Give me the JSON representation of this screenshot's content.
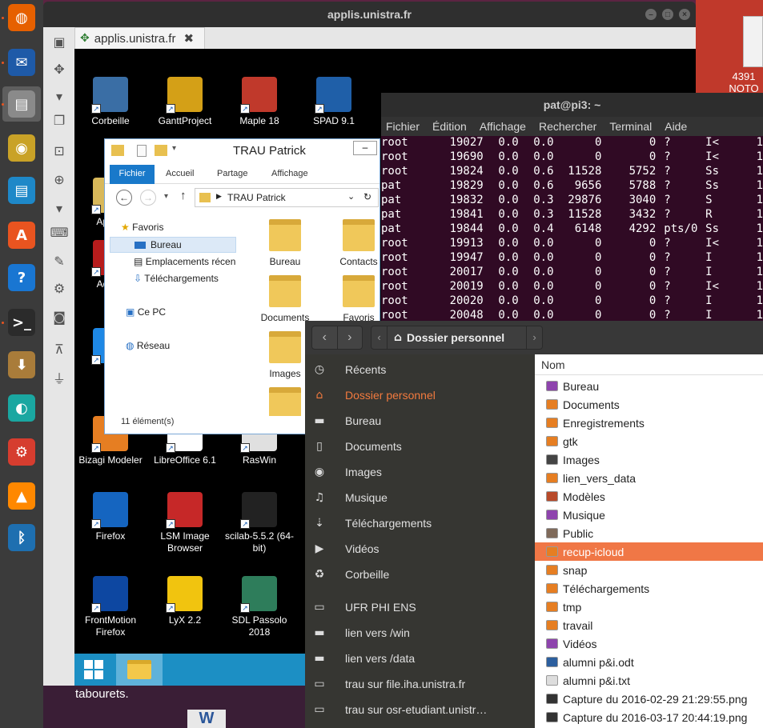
{
  "dock": {
    "items": [
      {
        "name": "firefox",
        "icon": "firefox-icon"
      },
      {
        "name": "thunderbird",
        "icon": "mail-icon"
      },
      {
        "name": "files",
        "icon": "files-icon"
      },
      {
        "name": "rhythmbox",
        "icon": "speaker-icon"
      },
      {
        "name": "writer",
        "icon": "writer-icon"
      },
      {
        "name": "software",
        "icon": "software-store-icon"
      },
      {
        "name": "help",
        "icon": "help-icon"
      },
      {
        "name": "terminal",
        "icon": "terminal-icon"
      },
      {
        "name": "archive",
        "icon": "archive-icon"
      },
      {
        "name": "remmina",
        "icon": "remote-desktop-icon"
      },
      {
        "name": "settings",
        "icon": "settings-icon"
      },
      {
        "name": "vlc",
        "icon": "vlc-icon"
      },
      {
        "name": "bluetooth",
        "icon": "bluetooth-icon"
      }
    ]
  },
  "right_desktop": {
    "label1": "4391",
    "label2": "NOTO"
  },
  "remote_window": {
    "title": "applis.unistra.fr",
    "tab_label": "applis.unistra.fr",
    "desktop_icons": [
      {
        "label": "Corbeille",
        "color": "#3a6ea5"
      },
      {
        "label": "GanttProject",
        "color": "#d4a017"
      },
      {
        "label": "Maple 18",
        "color": "#c0392b"
      },
      {
        "label": "SPAD 9.1",
        "color": "#1f5fa8"
      },
      {
        "label": "Appl P",
        "color": "#d8b85a"
      },
      {
        "label": "Adobe",
        "color": "#b71c1c"
      },
      {
        "label": "A",
        "color": "#1e88e5"
      },
      {
        "label": "Bizagi Modeler",
        "color": "#e67e22"
      },
      {
        "label": "LibreOffice 6.1",
        "color": "#ffffff"
      },
      {
        "label": "RasWin",
        "color": "#e0e0e0"
      },
      {
        "label": "Firefox",
        "color": "#1565c0"
      },
      {
        "label": "LSM Image Browser",
        "color": "#c62828"
      },
      {
        "label": "scilab-5.5.2 (64-bit)",
        "color": "#222222"
      },
      {
        "label": "FrontMotion Firefox",
        "color": "#0d47a1"
      },
      {
        "label": "LyX 2.2",
        "color": "#f1c40f"
      },
      {
        "label": "SDL Passolo 2018",
        "color": "#2e7d5b"
      }
    ],
    "bottom_text": "tabourets."
  },
  "explorer": {
    "title": "TRAU Patrick",
    "ribbon_tabs": [
      "Fichier",
      "Accueil",
      "Partage",
      "Affichage"
    ],
    "address": "TRAU Patrick",
    "nav": {
      "favoris": "Favoris",
      "bureau": "Bureau",
      "emplacements": "Emplacements récen",
      "telechargements": "Téléchargements",
      "ce_pc": "Ce PC",
      "reseau": "Réseau"
    },
    "items": [
      "Bureau",
      "Contacts",
      "Documents",
      "Favoris",
      "Images",
      ""
    ],
    "status": "11 élément(s)"
  },
  "terminal": {
    "title": "pat@pi3: ~",
    "menu": [
      "Fichier",
      "Édition",
      "Affichage",
      "Rechercher",
      "Terminal",
      "Aide"
    ],
    "rows": [
      [
        "root",
        "19027",
        "0.0",
        "0.0",
        "0",
        "0",
        "?",
        "I<",
        "1"
      ],
      [
        "root",
        "19690",
        "0.0",
        "0.0",
        "0",
        "0",
        "?",
        "I<",
        "1"
      ],
      [
        "root",
        "19824",
        "0.0",
        "0.6",
        "11528",
        "5752",
        "?",
        "Ss",
        "1"
      ],
      [
        "pat",
        "19829",
        "0.0",
        "0.6",
        "9656",
        "5788",
        "?",
        "Ss",
        "1"
      ],
      [
        "pat",
        "19832",
        "0.0",
        "0.3",
        "29876",
        "3040",
        "?",
        "S",
        "1"
      ],
      [
        "pat",
        "19841",
        "0.0",
        "0.3",
        "11528",
        "3432",
        "?",
        "R",
        "1"
      ],
      [
        "pat",
        "19844",
        "0.0",
        "0.4",
        "6148",
        "4292",
        "pts/0",
        "Ss",
        "1"
      ],
      [
        "root",
        "19913",
        "0.0",
        "0.0",
        "0",
        "0",
        "?",
        "I<",
        "1"
      ],
      [
        "root",
        "19947",
        "0.0",
        "0.0",
        "0",
        "0",
        "?",
        "I",
        "1"
      ],
      [
        "root",
        "20017",
        "0.0",
        "0.0",
        "0",
        "0",
        "?",
        "I",
        "1"
      ],
      [
        "root",
        "20019",
        "0.0",
        "0.0",
        "0",
        "0",
        "?",
        "I<",
        "1"
      ],
      [
        "root",
        "20020",
        "0.0",
        "0.0",
        "0",
        "0",
        "?",
        "I",
        "1"
      ],
      [
        "root",
        "20048",
        "0.0",
        "0.0",
        "0",
        "0",
        "?",
        "I",
        "1"
      ]
    ]
  },
  "files": {
    "location": "Dossier personnel",
    "sidebar": [
      {
        "label": "Récents",
        "icon": "clock-icon",
        "glyph": "◷"
      },
      {
        "label": "Dossier personnel",
        "icon": "home-icon",
        "glyph": "⌂"
      },
      {
        "label": "Bureau",
        "icon": "folder-icon",
        "glyph": "▬"
      },
      {
        "label": "Documents",
        "icon": "document-icon",
        "glyph": "▯"
      },
      {
        "label": "Images",
        "icon": "camera-icon",
        "glyph": "◉"
      },
      {
        "label": "Musique",
        "icon": "music-icon",
        "glyph": "♫"
      },
      {
        "label": "Téléchargements",
        "icon": "download-icon",
        "glyph": "⇣"
      },
      {
        "label": "Vidéos",
        "icon": "video-icon",
        "glyph": "▶"
      },
      {
        "label": "Corbeille",
        "icon": "trash-icon",
        "glyph": "♻"
      },
      {
        "label": "UFR PHI ENS",
        "icon": "network-drive-icon",
        "glyph": "▭"
      },
      {
        "label": "lien vers /win",
        "icon": "folder-icon",
        "glyph": "▬"
      },
      {
        "label": "lien vers /data",
        "icon": "folder-icon",
        "glyph": "▬"
      },
      {
        "label": "trau sur file.iha.unistra.fr",
        "icon": "network-drive-icon",
        "glyph": "▭"
      },
      {
        "label": "trau sur osr-etudiant.unistr…",
        "icon": "network-drive-icon",
        "glyph": "▭"
      }
    ],
    "column_header": "Nom",
    "entries": [
      {
        "name": "Bureau",
        "color": "#8e44ad"
      },
      {
        "name": "Documents",
        "color": "#e67e22"
      },
      {
        "name": "Enregistrements",
        "color": "#e67e22"
      },
      {
        "name": "gtk",
        "color": "#e67e22"
      },
      {
        "name": "Images",
        "color": "#444444"
      },
      {
        "name": "lien_vers_data",
        "color": "#e67e22"
      },
      {
        "name": "Modèles",
        "color": "#b84a2a"
      },
      {
        "name": "Musique",
        "color": "#8e44ad"
      },
      {
        "name": "Public",
        "color": "#7f6a5a"
      },
      {
        "name": "recup-icloud",
        "color": "#e67e22"
      },
      {
        "name": "snap",
        "color": "#e67e22"
      },
      {
        "name": "Téléchargements",
        "color": "#e67e22"
      },
      {
        "name": "tmp",
        "color": "#e67e22"
      },
      {
        "name": "travail",
        "color": "#e67e22"
      },
      {
        "name": "Vidéos",
        "color": "#8e44ad"
      },
      {
        "name": "alumni p&i.odt",
        "color": "#2c5f9e"
      },
      {
        "name": "alumni p&i.txt",
        "color": "#dddddd"
      },
      {
        "name": "Capture du 2016-02-29 21:29:55.png",
        "color": "#333333"
      },
      {
        "name": "Capture du 2016-03-17 20:44:19.png",
        "color": "#333333"
      }
    ],
    "selected": "recup-icloud"
  }
}
